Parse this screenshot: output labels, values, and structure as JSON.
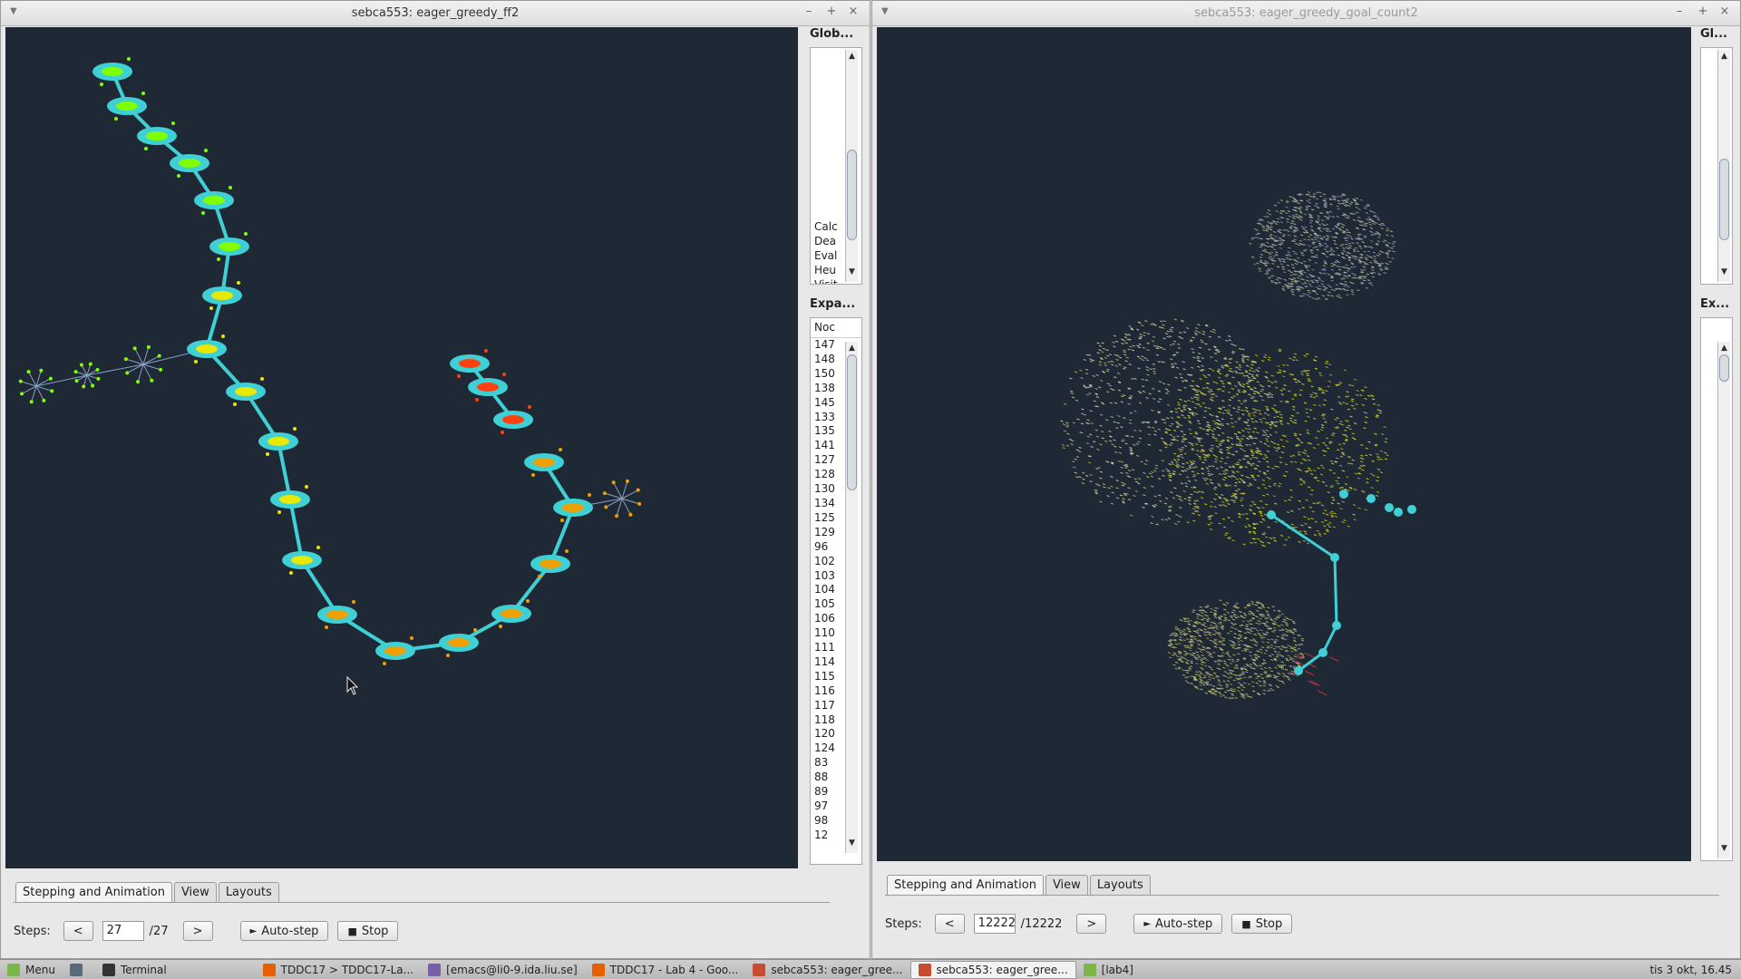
{
  "left_window": {
    "title": "sebca553: eager_greedy_ff2",
    "global_panel": {
      "title": "Glob...",
      "items": [
        "Calc",
        "Dea",
        "Eval",
        "Heu",
        "Visit"
      ]
    },
    "expanded_panel": {
      "title": "Expa...",
      "column_header": "Noc",
      "items": [
        "147",
        "148",
        "150",
        "138",
        "145",
        "133",
        "135",
        "141",
        "127",
        "128",
        "130",
        "134",
        "125",
        "129",
        "96",
        "102",
        "103",
        "104",
        "105",
        "106",
        "110",
        "111",
        "114",
        "115",
        "116",
        "117",
        "118",
        "120",
        "124",
        "83",
        "88",
        "89",
        "97",
        "98",
        "12"
      ]
    },
    "tabs": [
      "Stepping and Animation",
      "View",
      "Layouts"
    ],
    "steps_label": "Steps:",
    "prev_label": "<",
    "next_label": ">",
    "step_value": "27",
    "step_total": "/27",
    "autostep_label": "Auto-step",
    "stop_label": "Stop"
  },
  "right_window": {
    "title": "sebca553: eager_greedy_goal_count2",
    "global_panel": {
      "title": "Gl..."
    },
    "expanded_panel": {
      "title": "Ex..."
    },
    "tabs": [
      "Stepping and Animation",
      "View",
      "Layouts"
    ],
    "steps_label": "Steps:",
    "prev_label": "<",
    "next_label": ">",
    "step_value": "12222",
    "step_total": "/12222",
    "autostep_label": "Auto-step",
    "stop_label": "Stop"
  },
  "taskbar": {
    "items": [
      {
        "label": "Menu",
        "icon": "menu-icon"
      },
      {
        "label": "",
        "icon": "show-desktop-icon"
      },
      {
        "label": "Terminal",
        "icon": "terminal-icon"
      },
      {
        "label": "TDDC17 > TDDC17-La...",
        "icon": "firefox-icon"
      },
      {
        "label": "[emacs@li0-9.ida.liu.se]",
        "icon": "emacs-icon"
      },
      {
        "label": "TDDC17 - Lab 4 - Goo...",
        "icon": "firefox-icon"
      },
      {
        "label": "sebca553: eager_gree...",
        "icon": "java-icon"
      },
      {
        "label": "sebca553: eager_gree...",
        "icon": "java-icon"
      },
      {
        "label": "[lab4]",
        "icon": "folder-icon"
      }
    ],
    "clock": "tis 3 okt, 16.45"
  },
  "colors": {
    "canvas_bg": "#1f2935",
    "edge": "#3fd0d6",
    "node_green": "#7fff00",
    "node_yellow": "#e8e800",
    "node_orange": "#f0a000",
    "node_red": "#ff4010"
  }
}
